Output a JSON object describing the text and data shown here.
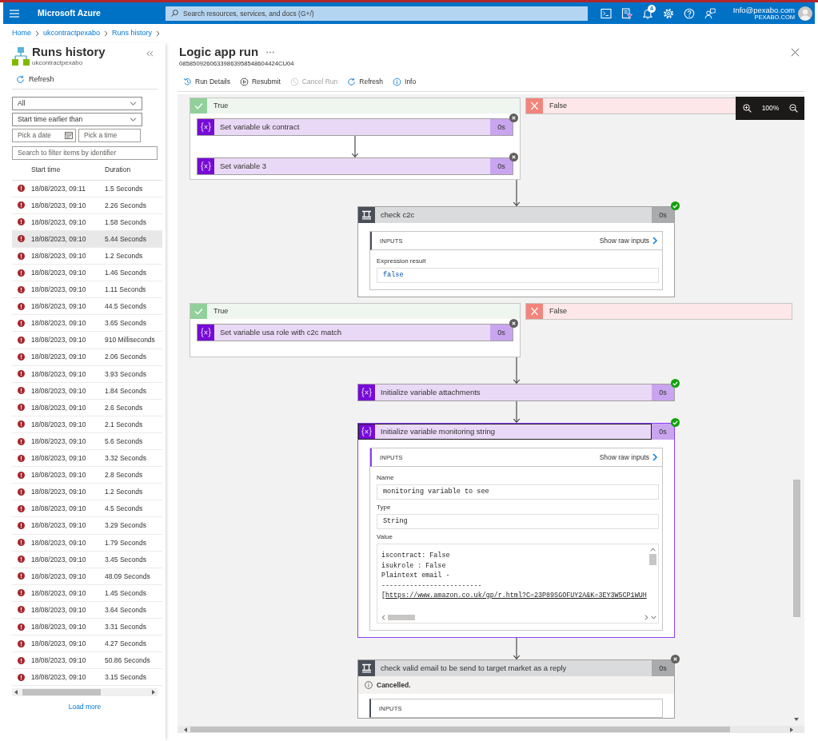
{
  "top_bar": {
    "brand": "Microsoft Azure",
    "search_placeholder": "Search resources, services, and docs (G+/)",
    "notification_count": "4",
    "account_email": "Info@pexabo.com",
    "account_tenant": "PEXABO.COM"
  },
  "breadcrumb": [
    "Home",
    "ukcontractpexabo",
    "Runs history"
  ],
  "runs_panel": {
    "title": "Runs history",
    "subtitle": "ukcontractpexabo",
    "refresh": "Refresh",
    "status_filter": "All",
    "time_filter": "Start time earlier than",
    "date_placeholder": "Pick a date",
    "time_placeholder": "Pick a time",
    "search_placeholder": "Search to filter items by identifier",
    "columns": [
      "Start time",
      "Duration"
    ],
    "rows": [
      {
        "start": "18/08/2023, 09:11",
        "duration": "1.5 Seconds",
        "failed": true,
        "selected": false
      },
      {
        "start": "18/08/2023, 09:10",
        "duration": "2.26 Seconds",
        "failed": true,
        "selected": false
      },
      {
        "start": "18/08/2023, 09:10",
        "duration": "1.58 Seconds",
        "failed": true,
        "selected": false
      },
      {
        "start": "18/08/2023, 09:10",
        "duration": "5.44 Seconds",
        "failed": true,
        "selected": true
      },
      {
        "start": "18/08/2023, 09:10",
        "duration": "1.2 Seconds",
        "failed": true,
        "selected": false
      },
      {
        "start": "18/08/2023, 09:10",
        "duration": "1.46 Seconds",
        "failed": true,
        "selected": false
      },
      {
        "start": "18/08/2023, 09:10",
        "duration": "1.11 Seconds",
        "failed": true,
        "selected": false
      },
      {
        "start": "18/08/2023, 09:10",
        "duration": "44.5 Seconds",
        "failed": true,
        "selected": false
      },
      {
        "start": "18/08/2023, 09:10",
        "duration": "3.65 Seconds",
        "failed": true,
        "selected": false
      },
      {
        "start": "18/08/2023, 09:10",
        "duration": "910 Milliseconds",
        "failed": true,
        "selected": false
      },
      {
        "start": "18/08/2023, 09:10",
        "duration": "2.06 Seconds",
        "failed": true,
        "selected": false
      },
      {
        "start": "18/08/2023, 09:10",
        "duration": "3.93 Seconds",
        "failed": true,
        "selected": false
      },
      {
        "start": "18/08/2023, 09:10",
        "duration": "1.84 Seconds",
        "failed": true,
        "selected": false
      },
      {
        "start": "18/08/2023, 09:10",
        "duration": "2.6 Seconds",
        "failed": true,
        "selected": false
      },
      {
        "start": "18/08/2023, 09:10",
        "duration": "2.1 Seconds",
        "failed": true,
        "selected": false
      },
      {
        "start": "18/08/2023, 09:10",
        "duration": "5.6 Seconds",
        "failed": true,
        "selected": false
      },
      {
        "start": "18/08/2023, 09:10",
        "duration": "3.32 Seconds",
        "failed": true,
        "selected": false
      },
      {
        "start": "18/08/2023, 09:10",
        "duration": "2.8 Seconds",
        "failed": true,
        "selected": false
      },
      {
        "start": "18/08/2023, 09:10",
        "duration": "1.2 Seconds",
        "failed": true,
        "selected": false
      },
      {
        "start": "18/08/2023, 09:10",
        "duration": "4.5 Seconds",
        "failed": true,
        "selected": false
      },
      {
        "start": "18/08/2023, 09:10",
        "duration": "3.29 Seconds",
        "failed": true,
        "selected": false
      },
      {
        "start": "18/08/2023, 09:10",
        "duration": "1.79 Seconds",
        "failed": true,
        "selected": false
      },
      {
        "start": "18/08/2023, 09:10",
        "duration": "3.45 Seconds",
        "failed": true,
        "selected": false
      },
      {
        "start": "18/08/2023, 09:10",
        "duration": "48.09 Seconds",
        "failed": true,
        "selected": false
      },
      {
        "start": "18/08/2023, 09:10",
        "duration": "1.45 Seconds",
        "failed": true,
        "selected": false
      },
      {
        "start": "18/08/2023, 09:10",
        "duration": "3.64 Seconds",
        "failed": true,
        "selected": false
      },
      {
        "start": "18/08/2023, 09:10",
        "duration": "3.31 Seconds",
        "failed": true,
        "selected": false
      },
      {
        "start": "18/08/2023, 09:10",
        "duration": "4.27 Seconds",
        "failed": true,
        "selected": false
      },
      {
        "start": "18/08/2023, 09:10",
        "duration": "50.86 Seconds",
        "failed": true,
        "selected": false
      },
      {
        "start": "18/08/2023, 09:10",
        "duration": "3.15 Seconds",
        "failed": true,
        "selected": false
      }
    ],
    "load_more": "Load more"
  },
  "run_panel": {
    "title": "Logic app run",
    "run_id": "08585092606339863958548604424CU04",
    "toolbar": [
      {
        "label": "Run Details",
        "disabled": false
      },
      {
        "label": "Resubmit",
        "disabled": false
      },
      {
        "label": "Cancel Run",
        "disabled": true
      },
      {
        "label": "Refresh",
        "disabled": false
      },
      {
        "label": "Info",
        "disabled": false
      }
    ],
    "zoom": "100%",
    "flow": [
      {
        "kind": "branches",
        "branches": [
          {
            "kind": "true",
            "label": "True",
            "actions": [
              {
                "kind": "variable",
                "title": "Set variable uk contract",
                "duration": "0s",
                "succeeded": false,
                "selected": false,
                "expanded": false
              },
              {
                "kind": "variable",
                "title": "Set variable 3",
                "duration": "0s",
                "succeeded": false,
                "selected": false,
                "expanded": false
              }
            ]
          },
          {
            "kind": "false",
            "label": "False"
          }
        ]
      },
      {
        "kind": "condition",
        "title": "check c2c",
        "duration": "0s",
        "succeeded": true,
        "selected": false,
        "expanded": true,
        "inputs": {
          "heading": "INPUTS",
          "raw_link": "Show raw inputs",
          "fields": [
            {
              "kind": "code",
              "label": "Expression result",
              "value": "false"
            }
          ]
        }
      },
      {
        "kind": "branches",
        "branches": [
          {
            "kind": "true",
            "label": "True",
            "actions": [
              {
                "kind": "variable",
                "title": "Set variable usa role with c2c match",
                "duration": "0s",
                "succeeded": false,
                "selected": false,
                "expanded": false
              }
            ]
          },
          {
            "kind": "false",
            "label": "False"
          }
        ]
      },
      {
        "kind": "variable",
        "title": "Initialize variable attachments",
        "duration": "0s",
        "succeeded": true,
        "selected": false,
        "expanded": false
      },
      {
        "kind": "variable",
        "title": "Initialize variable monitoring string",
        "duration": "0s",
        "succeeded": true,
        "selected": true,
        "expanded": true,
        "inputs": {
          "heading": "INPUTS",
          "raw_link": "Show raw inputs",
          "fields": [
            {
              "kind": "text",
              "label": "Name",
              "value": "monitoring variable to see"
            },
            {
              "kind": "text",
              "label": "Type",
              "value": "String"
            },
            {
              "kind": "multiline",
              "label": "Value",
              "lines": [
                "iscontract: False",
                "isukrole : False",
                "Plaintext email -",
                "-------------------------"
              ],
              "link_prefix": "[",
              "link": "https://www.amazon.co.uk/gp/r.html?C=23P89SGOFUY2A&K=3EY3W5CP1WUH"
            }
          ]
        }
      },
      {
        "kind": "condition",
        "title": "check valid email to be send to target market as a reply",
        "duration": "0s",
        "succeeded": false,
        "selected": false,
        "expanded": true,
        "message": "Cancelled.",
        "inputs": {
          "heading": "INPUTS"
        }
      }
    ]
  }
}
